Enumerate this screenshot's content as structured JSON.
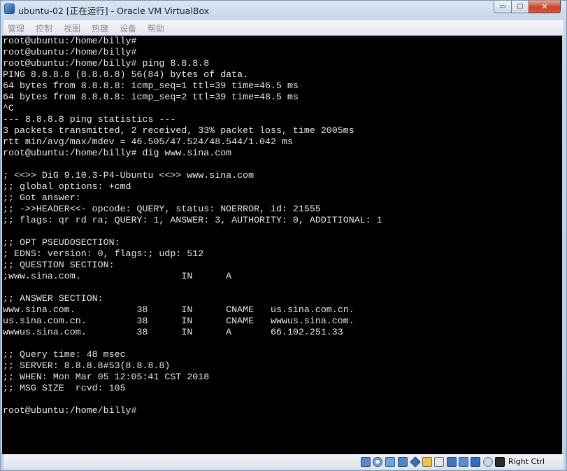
{
  "window": {
    "title": "ubuntu-02 [正在运行] - Oracle VM VirtualBox",
    "controls": {
      "minimize": "▭",
      "maximize": "▢",
      "close": "✕"
    }
  },
  "menubar": {
    "items": [
      {
        "label": "管理"
      },
      {
        "label": "控制"
      },
      {
        "label": "视图"
      },
      {
        "label": "热键"
      },
      {
        "label": "设备"
      },
      {
        "label": "帮助"
      }
    ]
  },
  "terminal": {
    "lines": [
      "root@ubuntu:/home/billy#",
      "root@ubuntu:/home/billy#",
      "root@ubuntu:/home/billy# ping 8.8.8.8",
      "PING 8.8.8.8 (8.8.8.8) 56(84) bytes of data.",
      "64 bytes from 8.8.8.8: icmp_seq=1 ttl=39 time=46.5 ms",
      "64 bytes from 8.8.8.8: icmp_seq=2 ttl=39 time=48.5 ms",
      "^C",
      "--- 8.8.8.8 ping statistics ---",
      "3 packets transmitted, 2 received, 33% packet loss, time 2005ms",
      "rtt min/avg/max/mdev = 46.505/47.524/48.544/1.042 ms",
      "root@ubuntu:/home/billy# dig www.sina.com",
      "",
      "; <<>> DiG 9.10.3-P4-Ubuntu <<>> www.sina.com",
      ";; global options: +cmd",
      ";; Got answer:",
      ";; ->>HEADER<<- opcode: QUERY, status: NOERROR, id: 21555",
      ";; flags: qr rd ra; QUERY: 1, ANSWER: 3, AUTHORITY: 0, ADDITIONAL: 1",
      "",
      ";; OPT PSEUDOSECTION:",
      "; EDNS: version: 0, flags:; udp: 512",
      ";; QUESTION SECTION:",
      ";www.sina.com.                  IN      A",
      "",
      ";; ANSWER SECTION:",
      "www.sina.com.           38      IN      CNAME   us.sina.com.cn.",
      "us.sina.com.cn.         38      IN      CNAME   wwwus.sina.com.",
      "wwwus.sina.com.         38      IN      A       66.102.251.33",
      "",
      ";; Query time: 48 msec",
      ";; SERVER: 8.8.8.8#53(8.8.8.8)",
      ";; WHEN: Mon Mar 05 12:05:41 CST 2018",
      ";; MSG SIZE  rcvd: 105",
      "",
      "root@ubuntu:/home/billy#"
    ]
  },
  "statusbar": {
    "icons": [
      "hard-disk-icon",
      "optical-drive-icon",
      "audio-icon",
      "network-icon",
      "usb-icon",
      "shared-folders-icon",
      "display-icon",
      "video-capture-icon",
      "cpu-icon",
      "virtualization-icon",
      "mouse-integration-icon",
      "keyboard-icon"
    ],
    "host_key": "Right Ctrl"
  }
}
